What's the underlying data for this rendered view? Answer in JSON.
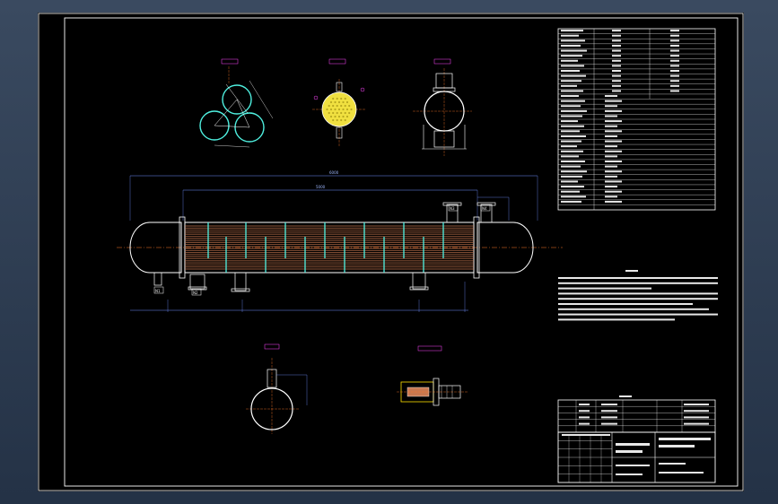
{
  "drawing": {
    "spec_table_rows": 36,
    "notes_lines": 9,
    "parts_rows": 4,
    "title_rows": 6,
    "tube_count": 22,
    "nozzle_labels": [
      "N1",
      "N2",
      "N3",
      "N4"
    ]
  },
  "colors": {
    "background": "#000000",
    "frame": "#ffffff",
    "shell": "#ffffff",
    "tubes": "#c87850",
    "baffles": "#4ff0e0",
    "dimension": "#6f8fff",
    "centerline": "#ff7a2a",
    "label": "#ff44ff",
    "tubesheet_fill": "#f0e040",
    "nozzle": "#ffe000"
  },
  "icons": {
    "triangle_pitch": "three-circle-layout-icon",
    "tubesheet": "tubesheet-disc-icon",
    "end_view": "end-view-icon",
    "detail": "detail-section-icon"
  }
}
